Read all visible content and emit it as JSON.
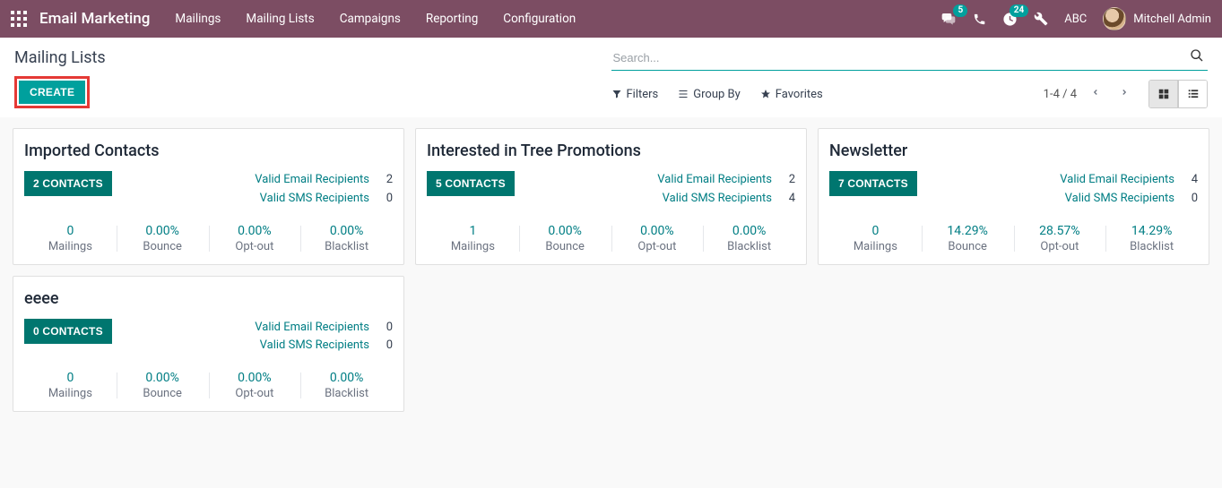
{
  "topbar": {
    "app_title": "Email Marketing",
    "nav": [
      "Mailings",
      "Mailing Lists",
      "Campaigns",
      "Reporting",
      "Configuration"
    ],
    "chat_badge": "5",
    "clock_badge": "24",
    "company": "ABC",
    "user_name": "Mitchell Admin"
  },
  "header": {
    "page_title": "Mailing Lists",
    "create_label": "CREATE",
    "search_placeholder": "Search...",
    "filters_label": "Filters",
    "groupby_label": "Group By",
    "favorites_label": "Favorites",
    "pager": "1-4 / 4"
  },
  "labels": {
    "valid_email": "Valid Email Recipients",
    "valid_sms": "Valid SMS Recipients",
    "mailings": "Mailings",
    "bounce": "Bounce",
    "optout": "Opt-out",
    "blacklist": "Blacklist"
  },
  "cards": [
    {
      "title": "Imported Contacts",
      "contacts_btn": "2 CONTACTS",
      "valid_email": "2",
      "valid_sms": "0",
      "mailings": "0",
      "bounce": "0.00%",
      "optout": "0.00%",
      "blacklist": "0.00%"
    },
    {
      "title": "Interested in Tree Promotions",
      "contacts_btn": "5 CONTACTS",
      "valid_email": "2",
      "valid_sms": "4",
      "mailings": "1",
      "bounce": "0.00%",
      "optout": "0.00%",
      "blacklist": "0.00%"
    },
    {
      "title": "Newsletter",
      "contacts_btn": "7 CONTACTS",
      "valid_email": "4",
      "valid_sms": "0",
      "mailings": "0",
      "bounce": "14.29%",
      "optout": "28.57%",
      "blacklist": "14.29%"
    },
    {
      "title": "eeee",
      "contacts_btn": "0 CONTACTS",
      "valid_email": "0",
      "valid_sms": "0",
      "mailings": "0",
      "bounce": "0.00%",
      "optout": "0.00%",
      "blacklist": "0.00%"
    }
  ]
}
